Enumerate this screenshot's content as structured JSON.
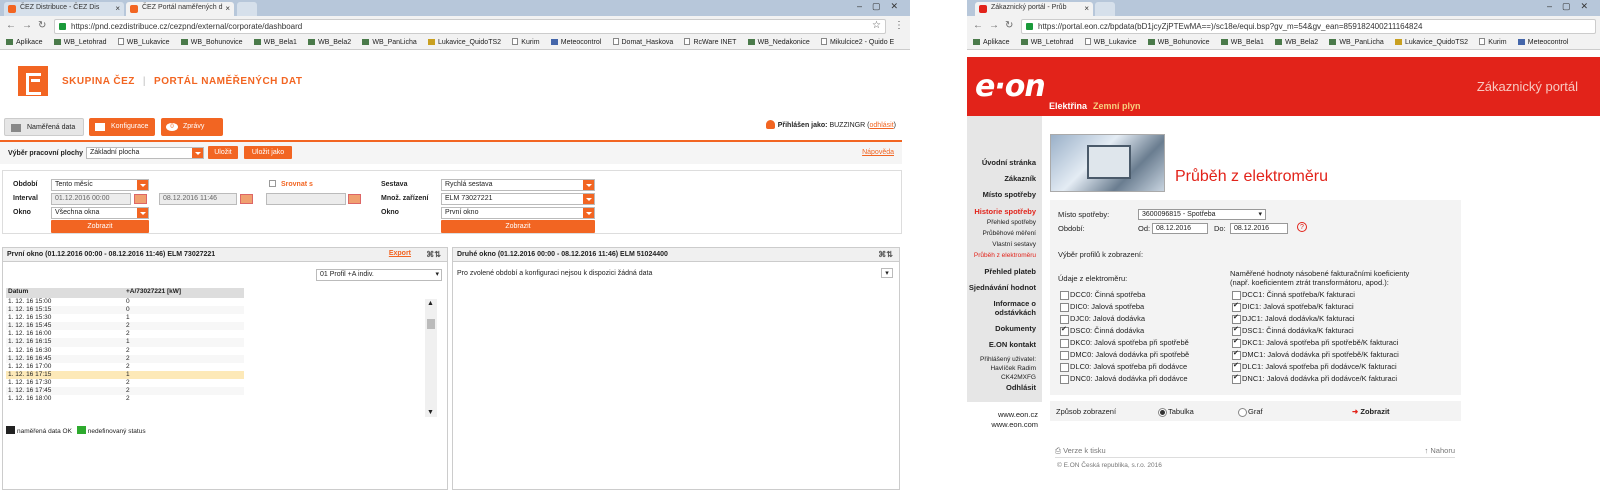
{
  "left_window": {
    "tabs": [
      {
        "label": "ČEZ Distribuce - ČEZ Dis"
      },
      {
        "label": "ČEZ Portál naměřených d"
      }
    ],
    "url": "https://pnd.cezdistribuce.cz/cezpnd/external/corporate/dashboard",
    "bookmarks": [
      "Aplikace",
      "WB_Letohrad",
      "WB_Lukavice",
      "WB_Bohunovice",
      "WB_Bela1",
      "WB_Bela2",
      "WB_PanLicha",
      "Lukavice_QuidoTS2",
      "Kurim",
      "Meteocontrol",
      "Domat_Haskova",
      "RcWare INET",
      "WB_Nedakonice",
      "Mikulcice2 - Quido E"
    ],
    "brand": {
      "group": "SKUPINA ČEZ",
      "portal": "PORTÁL NAMĚŘENÝCH DAT"
    },
    "main_tabs": [
      {
        "label": "Naměřená data"
      },
      {
        "label": "Konfigurace"
      },
      {
        "label": "Zprávy"
      }
    ],
    "messages_count": "0",
    "user": {
      "prefix": "Přihlášen jako:",
      "name": "BUZZINGR",
      "logout": "odhlásit"
    },
    "workspace": {
      "label": "Výběr pracovní plochy",
      "value": "Základní plocha",
      "save": "Uložit",
      "save_as": "Uložit jako",
      "help": "Nápověda"
    },
    "filter": {
      "period_label": "Období",
      "period_value": "Tento měsíc",
      "interval_label": "Interval",
      "interval_from": "01.12.2016 00:00",
      "interval_to": "08.12.2016 11:46",
      "window_label": "Okno",
      "window_value": "Všechna okna",
      "compare_label": "Srovnat s",
      "show": "Zobrazit",
      "set_label": "Sestava",
      "set_value": "Rychlá sestava",
      "devices_label": "Množ. zařízení",
      "devices_value": "ELM 73027221",
      "window2_label": "Okno",
      "window2_value": "První okno",
      "show2": "Zobrazit"
    },
    "pane1": {
      "title": "První okno (01.12.2016 00:00 - 08.12.2016 11:46) ELM 73027221",
      "export": "Export",
      "profile": "01 Profil +A indiv.",
      "col_date": "Datum",
      "col_value": "+A/73027221 [kW]",
      "rows": [
        [
          "1. 12. 16 15:00",
          "0"
        ],
        [
          "1. 12. 16 15:15",
          "0"
        ],
        [
          "1. 12. 16 15:30",
          "1"
        ],
        [
          "1. 12. 16 15:45",
          "2"
        ],
        [
          "1. 12. 16 16:00",
          "2"
        ],
        [
          "1. 12. 16 16:15",
          "1"
        ],
        [
          "1. 12. 16 16:30",
          "2"
        ],
        [
          "1. 12. 16 16:45",
          "2"
        ],
        [
          "1. 12. 16 17:00",
          "2"
        ],
        [
          "1. 12. 16 17:15",
          "1"
        ],
        [
          "1. 12. 16 17:30",
          "2"
        ],
        [
          "1. 12. 16 17:45",
          "2"
        ],
        [
          "1. 12. 16 18:00",
          "2"
        ]
      ],
      "legend_ok": "naměřená data OK",
      "legend_undef": "nedefinovaný status"
    },
    "pane2": {
      "title": "Druhé okno (01.12.2016 00:00 - 08.12.2016 11:46) ELM 51024400",
      "message": "Pro zvolené období a konfiguraci nejsou k dispozici žádná data"
    }
  },
  "right_window": {
    "tabs": [
      {
        "label": "Zákaznický portál - Průb"
      }
    ],
    "url": "https://portal.eon.cz/bpdata(bD1jcyZjPTEwMA==)/sc18e/equi.bsp?gv_m=54&gv_ean=859182400211164824",
    "bookmarks": [
      "Aplikace",
      "WB_Letohrad",
      "WB_Lukavice",
      "WB_Bohunovice",
      "WB_Bela1",
      "WB_Bela2",
      "WB_PanLicha",
      "Lukavice_QuidoTS2",
      "Kurim",
      "Meteocontrol"
    ],
    "logo": "e·on",
    "portal_title": "Zákaznický portál",
    "top_nav": {
      "electricity": "Elektřina",
      "gas": "Zemní plyn"
    },
    "left_nav": [
      "Úvodní stránka",
      "Zákazník",
      "Místo spotřeby",
      "Historie spotřeby",
      "Přehled spotřeby",
      "Průběhové měření",
      "Vlastní sestavy",
      "Průběh z elektroměru",
      "Přehled plateb",
      "Sjednávání hodnot",
      "Informace o",
      "odstávkách",
      "Dokumenty",
      "E.ON kontakt"
    ],
    "logged_user": {
      "label": "Přihlášený uživatel:",
      "name": "Havlíček Radim",
      "code": "CK42MXFG",
      "logout": "Odhlásit"
    },
    "footer_links": [
      "www.eon.cz",
      "www.eon.com"
    ],
    "heading": "Průběh z elektroměru",
    "form": {
      "place_label": "Místo spotřeby:",
      "place_value": "3600096815 - Spotřeba",
      "period_label": "Období:",
      "from_label": "Od:",
      "from_value": "08.12.2016",
      "to_label": "Do:",
      "to_value": "08.12.2016",
      "profile_label": "Výběr profilů k zobrazení:",
      "meter_label": "Údaje z elektroměru:",
      "coef_label": "Naměřené hodnoty násobené fakturačními koeficienty",
      "coef_label2": "(např. koeficientem ztrát transformátoru, apod.):",
      "left_checks": [
        {
          "label": "DCC0: Činná spotřeba",
          "checked": false
        },
        {
          "label": "DIC0: Jalová spotřeba",
          "checked": false
        },
        {
          "label": "DJC0: Jalová dodávka",
          "checked": false
        },
        {
          "label": "DSC0: Činná dodávka",
          "checked": true
        },
        {
          "label": "DKC0: Jalová spotřeba při spotřebě",
          "checked": false
        },
        {
          "label": "DMC0: Jalová dodávka při spotřebě",
          "checked": false
        },
        {
          "label": "DLC0: Jalová spotřeba při dodávce",
          "checked": false
        },
        {
          "label": "DNC0: Jalová dodávka při dodávce",
          "checked": false
        }
      ],
      "right_checks": [
        {
          "label": "DCC1: Činná spotřeba/K fakturaci",
          "checked": false
        },
        {
          "label": "DIC1: Jalová spotřeba/K fakturaci",
          "checked": true
        },
        {
          "label": "DJC1: Jalová dodávka/K fakturaci",
          "checked": true
        },
        {
          "label": "DSC1: Činná dodávka/K fakturaci",
          "checked": true
        },
        {
          "label": "DKC1: Jalová spotřeba při spotřebě/K fakturaci",
          "checked": true
        },
        {
          "label": "DMC1: Jalová dodávka při spotřebě/K fakturaci",
          "checked": true
        },
        {
          "label": "DLC1: Jalová spotřeba při dodávce/K fakturaci",
          "checked": true
        },
        {
          "label": "DNC1: Jalová dodávka při dodávce/K fakturaci",
          "checked": true
        }
      ]
    },
    "display": {
      "label": "Způsob zobrazení",
      "table": "Tabulka",
      "graph": "Graf",
      "show": "Zobrazit"
    },
    "print": "Verze k tisku",
    "top": "Nahoru",
    "copyright": "© E.ON Česká republika, s.r.o. 2016"
  },
  "colors": {
    "cez_orange": "#f26522",
    "eon_red": "#e2231a"
  }
}
